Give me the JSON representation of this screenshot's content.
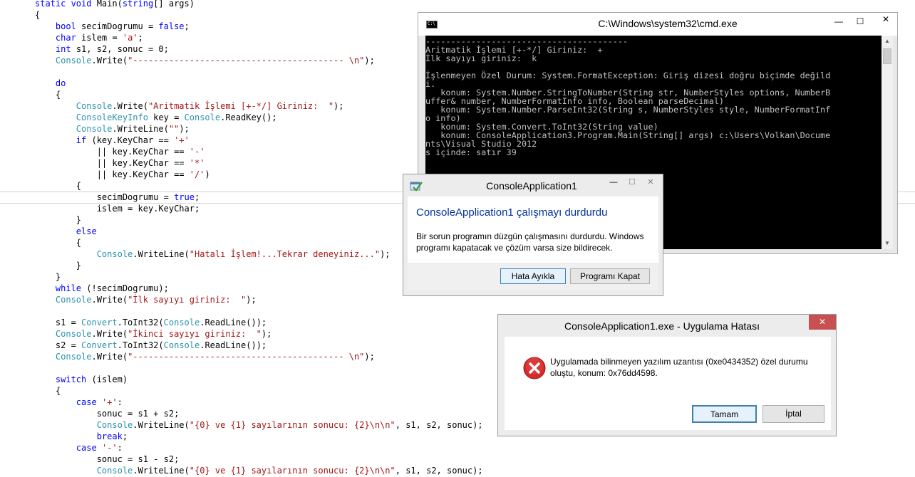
{
  "code": {
    "lines": [
      [
        {
          "t": "static void ",
          "c": "kw"
        },
        {
          "t": "Main(",
          "c": ""
        },
        {
          "t": "string",
          "c": "kw"
        },
        {
          "t": "[] args)",
          "c": ""
        }
      ],
      [
        {
          "t": "{",
          "c": ""
        }
      ],
      [
        {
          "t": "    ",
          "c": ""
        },
        {
          "t": "bool",
          "c": "kw"
        },
        {
          "t": " secimDogrumu = ",
          "c": ""
        },
        {
          "t": "false",
          "c": "kw"
        },
        {
          "t": ";",
          "c": ""
        }
      ],
      [
        {
          "t": "    ",
          "c": ""
        },
        {
          "t": "char",
          "c": "kw"
        },
        {
          "t": " islem = ",
          "c": ""
        },
        {
          "t": "'a'",
          "c": "st"
        },
        {
          "t": ";",
          "c": ""
        }
      ],
      [
        {
          "t": "    ",
          "c": ""
        },
        {
          "t": "int",
          "c": "kw"
        },
        {
          "t": " s1, s2, sonuc = 0;",
          "c": ""
        }
      ],
      [
        {
          "t": "    ",
          "c": ""
        },
        {
          "t": "Console",
          "c": "ty"
        },
        {
          "t": ".Write(",
          "c": ""
        },
        {
          "t": "\"----------------------------------------- \\n\"",
          "c": "st"
        },
        {
          "t": ");",
          "c": ""
        }
      ],
      [
        {
          "t": "",
          "c": ""
        }
      ],
      [
        {
          "t": "    ",
          "c": ""
        },
        {
          "t": "do",
          "c": "kw"
        }
      ],
      [
        {
          "t": "    {",
          "c": ""
        }
      ],
      [
        {
          "t": "        ",
          "c": ""
        },
        {
          "t": "Console",
          "c": "ty"
        },
        {
          "t": ".Write(",
          "c": ""
        },
        {
          "t": "\"Aritmatik İşlemi [+-*/] Giriniz:  \"",
          "c": "st"
        },
        {
          "t": ");",
          "c": ""
        }
      ],
      [
        {
          "t": "        ",
          "c": ""
        },
        {
          "t": "ConsoleKeyInfo",
          "c": "ty"
        },
        {
          "t": " key = ",
          "c": ""
        },
        {
          "t": "Console",
          "c": "ty"
        },
        {
          "t": ".ReadKey();",
          "c": ""
        }
      ],
      [
        {
          "t": "        ",
          "c": ""
        },
        {
          "t": "Console",
          "c": "ty"
        },
        {
          "t": ".WriteLine(",
          "c": ""
        },
        {
          "t": "\"\"",
          "c": "st"
        },
        {
          "t": ");",
          "c": ""
        }
      ],
      [
        {
          "t": "        ",
          "c": ""
        },
        {
          "t": "if",
          "c": "kw"
        },
        {
          "t": " (key.KeyChar == ",
          "c": ""
        },
        {
          "t": "'+'",
          "c": "st"
        }
      ],
      [
        {
          "t": "            || key.KeyChar == ",
          "c": ""
        },
        {
          "t": "'-'",
          "c": "st"
        }
      ],
      [
        {
          "t": "            || key.KeyChar == ",
          "c": ""
        },
        {
          "t": "'*'",
          "c": "st"
        }
      ],
      [
        {
          "t": "            || key.KeyChar == ",
          "c": ""
        },
        {
          "t": "'/'",
          "c": "st"
        },
        {
          "t": ")",
          "c": ""
        }
      ],
      [
        {
          "t": "        {",
          "c": ""
        }
      ],
      [
        {
          "t": "            secimDogrumu = ",
          "c": ""
        },
        {
          "t": "true",
          "c": "kw"
        },
        {
          "t": ";",
          "c": ""
        }
      ],
      [
        {
          "t": "            islem = key.KeyChar;",
          "c": ""
        }
      ],
      [
        {
          "t": "        }",
          "c": ""
        }
      ],
      [
        {
          "t": "        ",
          "c": ""
        },
        {
          "t": "else",
          "c": "kw"
        }
      ],
      [
        {
          "t": "        {",
          "c": ""
        }
      ],
      [
        {
          "t": "            ",
          "c": ""
        },
        {
          "t": "Console",
          "c": "ty"
        },
        {
          "t": ".WriteLine(",
          "c": ""
        },
        {
          "t": "\"Hatalı İşlem!...Tekrar deneyiniz...\"",
          "c": "st"
        },
        {
          "t": ");",
          "c": ""
        }
      ],
      [
        {
          "t": "        }",
          "c": ""
        }
      ],
      [
        {
          "t": "    }",
          "c": ""
        }
      ],
      [
        {
          "t": "    ",
          "c": ""
        },
        {
          "t": "while",
          "c": "kw"
        },
        {
          "t": " (!secimDogrumu);",
          "c": ""
        }
      ],
      [
        {
          "t": "    ",
          "c": ""
        },
        {
          "t": "Console",
          "c": "ty"
        },
        {
          "t": ".Write(",
          "c": ""
        },
        {
          "t": "\"İlk sayıyı giriniz:  \"",
          "c": "st"
        },
        {
          "t": ");",
          "c": ""
        }
      ],
      [
        {
          "t": "",
          "c": ""
        }
      ],
      [
        {
          "t": "    s1 = ",
          "c": ""
        },
        {
          "t": "Convert",
          "c": "ty"
        },
        {
          "t": ".ToInt32(",
          "c": ""
        },
        {
          "t": "Console",
          "c": "ty"
        },
        {
          "t": ".ReadLine());",
          "c": ""
        }
      ],
      [
        {
          "t": "    ",
          "c": ""
        },
        {
          "t": "Console",
          "c": "ty"
        },
        {
          "t": ".Write(",
          "c": ""
        },
        {
          "t": "\"İkinci sayıyı giriniz:  \"",
          "c": "st"
        },
        {
          "t": ");",
          "c": ""
        }
      ],
      [
        {
          "t": "    s2 = ",
          "c": ""
        },
        {
          "t": "Convert",
          "c": "ty"
        },
        {
          "t": ".ToInt32(",
          "c": ""
        },
        {
          "t": "Console",
          "c": "ty"
        },
        {
          "t": ".ReadLine());",
          "c": ""
        }
      ],
      [
        {
          "t": "    ",
          "c": ""
        },
        {
          "t": "Console",
          "c": "ty"
        },
        {
          "t": ".Write(",
          "c": ""
        },
        {
          "t": "\"----------------------------------------- \\n\"",
          "c": "st"
        },
        {
          "t": ");",
          "c": ""
        }
      ],
      [
        {
          "t": "",
          "c": ""
        }
      ],
      [
        {
          "t": "    ",
          "c": ""
        },
        {
          "t": "switch",
          "c": "kw"
        },
        {
          "t": " (islem)",
          "c": ""
        }
      ],
      [
        {
          "t": "    {",
          "c": ""
        }
      ],
      [
        {
          "t": "        ",
          "c": ""
        },
        {
          "t": "case",
          "c": "kw"
        },
        {
          "t": " ",
          "c": ""
        },
        {
          "t": "'+'",
          "c": "st"
        },
        {
          "t": ":",
          "c": ""
        }
      ],
      [
        {
          "t": "            sonuc = s1 + s2;",
          "c": ""
        }
      ],
      [
        {
          "t": "            ",
          "c": ""
        },
        {
          "t": "Console",
          "c": "ty"
        },
        {
          "t": ".WriteLine(",
          "c": ""
        },
        {
          "t": "\"{0} ve {1} sayılarının sonucu: {2}\\n\\n\"",
          "c": "st"
        },
        {
          "t": ", s1, s2, sonuc);",
          "c": ""
        }
      ],
      [
        {
          "t": "            ",
          "c": ""
        },
        {
          "t": "break",
          "c": "kw"
        },
        {
          "t": ";",
          "c": ""
        }
      ],
      [
        {
          "t": "        ",
          "c": ""
        },
        {
          "t": "case",
          "c": "kw"
        },
        {
          "t": " ",
          "c": ""
        },
        {
          "t": "'-'",
          "c": "st"
        },
        {
          "t": ":",
          "c": ""
        }
      ],
      [
        {
          "t": "            sonuc = s1 - s2;",
          "c": ""
        }
      ],
      [
        {
          "t": "            ",
          "c": ""
        },
        {
          "t": "Console",
          "c": "ty"
        },
        {
          "t": ".WriteLine(",
          "c": ""
        },
        {
          "t": "\"{0} ve {1} sayılarının sonucu: {2}\\n\\n\"",
          "c": "st"
        },
        {
          "t": ", s1, s2, sonuc);",
          "c": ""
        }
      ]
    ]
  },
  "cmd": {
    "title": "C:\\Windows\\system32\\cmd.exe",
    "icon_label": "C:\\",
    "minimize": "—",
    "maximize": "☐",
    "close": "✕",
    "lines": [
      "----------------------------------------",
      "Aritmatik İşlemi [+-*/] Giriniz:  +",
      "İlk sayıyı giriniz:  k",
      "",
      "İşlenmeyen Özel Durum: System.FormatException: Giriş dizesi doğru biçimde değild",
      "i.",
      "   konum: System.Number.StringToNumber(String str, NumberStyles options, NumberB",
      "uffer& number, NumberFormatInfo info, Boolean parseDecimal)",
      "   konum: System.Number.ParseInt32(String s, NumberStyles style, NumberFormatInf",
      "o info)",
      "   konum: System.Convert.ToInt32(String value)",
      "   konum: ConsoleApplication3.Program.Main(String[] args) c:\\Users\\Volkan\\Docume",
      "nts\\Visual Studio 2012",
      "s içinde: satır 39"
    ]
  },
  "stopped_dialog": {
    "title": "ConsoleApplication1",
    "heading": "ConsoleApplication1 çalışmayı durdurdu",
    "message": "Bir sorun programın düzgün çalışmasını durdurdu. Windows programı kapatacak ve çözüm varsa size bildirecek.",
    "debug_button": "Hata Ayıkla",
    "close_program_button": "Programı Kapat",
    "minimize": "—",
    "maximize": "☐",
    "close": "✕"
  },
  "error_dialog": {
    "title": "ConsoleApplication1.exe - Uygulama Hatası",
    "message": "Uygulamada bilinmeyen yazılım uzantısı (0xe0434352) özel durumu oluştu, konum: 0x76dd4598.",
    "ok_button": "Tamam",
    "cancel_button": "İptal",
    "close": "✕"
  }
}
